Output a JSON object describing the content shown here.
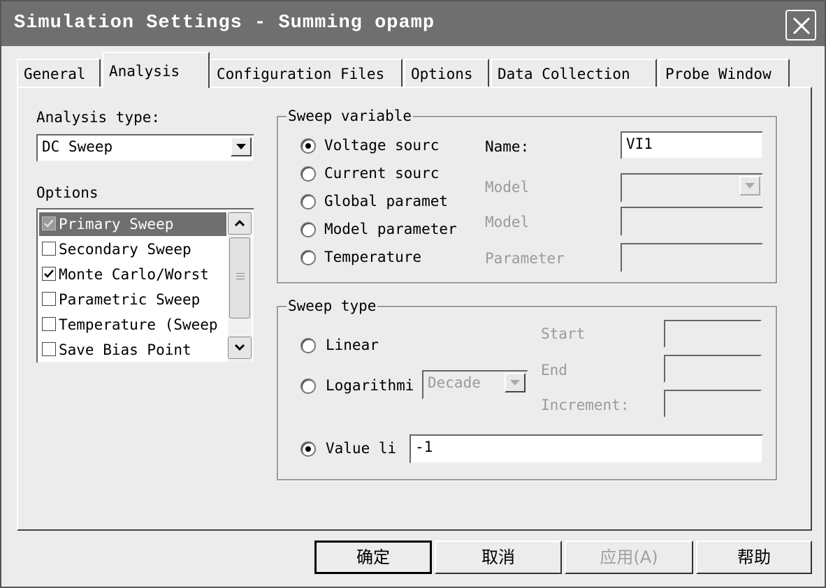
{
  "window": {
    "title": "Simulation Settings - Summing opamp"
  },
  "tabs": [
    {
      "label": "General"
    },
    {
      "label": "Analysis"
    },
    {
      "label": "Configuration Files"
    },
    {
      "label": "Options"
    },
    {
      "label": "Data Collection"
    },
    {
      "label": "Probe Window"
    }
  ],
  "active_tab": "Analysis",
  "analysis": {
    "type_label": "Analysis type:",
    "type_value": "DC Sweep",
    "options_label": "Options",
    "options": [
      {
        "label": "Primary Sweep",
        "checked": true,
        "selected": true
      },
      {
        "label": "Secondary Sweep",
        "checked": false
      },
      {
        "label": "Monte Carlo/Worst",
        "checked": true
      },
      {
        "label": "Parametric Sweep",
        "checked": false
      },
      {
        "label": "Temperature (Sweep",
        "checked": false
      },
      {
        "label": "Save Bias Point",
        "checked": false
      }
    ]
  },
  "sweep_variable": {
    "title": "Sweep variable",
    "radios": [
      {
        "label": "Voltage sourc",
        "selected": true
      },
      {
        "label": "Current sourc",
        "selected": false
      },
      {
        "label": "Global paramet",
        "selected": false
      },
      {
        "label": "Model parameter",
        "selected": false
      },
      {
        "label": "Temperature",
        "selected": false
      }
    ],
    "name_label": "Name:",
    "name_value": "VI1",
    "model_type_label": "Model",
    "model_name_label": "Model",
    "parameter_label": "Parameter"
  },
  "sweep_type": {
    "title": "Sweep type",
    "linear_label": "Linear",
    "log_label": "Logarithmi",
    "log_unit": "Decade",
    "value_list_label": "Value li",
    "value_list_value": "-1",
    "start_label": "Start",
    "end_label": "End",
    "increment_label": "Increment:",
    "selected": "value_list"
  },
  "buttons": {
    "ok": "确定",
    "cancel": "取消",
    "apply": "应用(A)",
    "help": "帮助"
  }
}
